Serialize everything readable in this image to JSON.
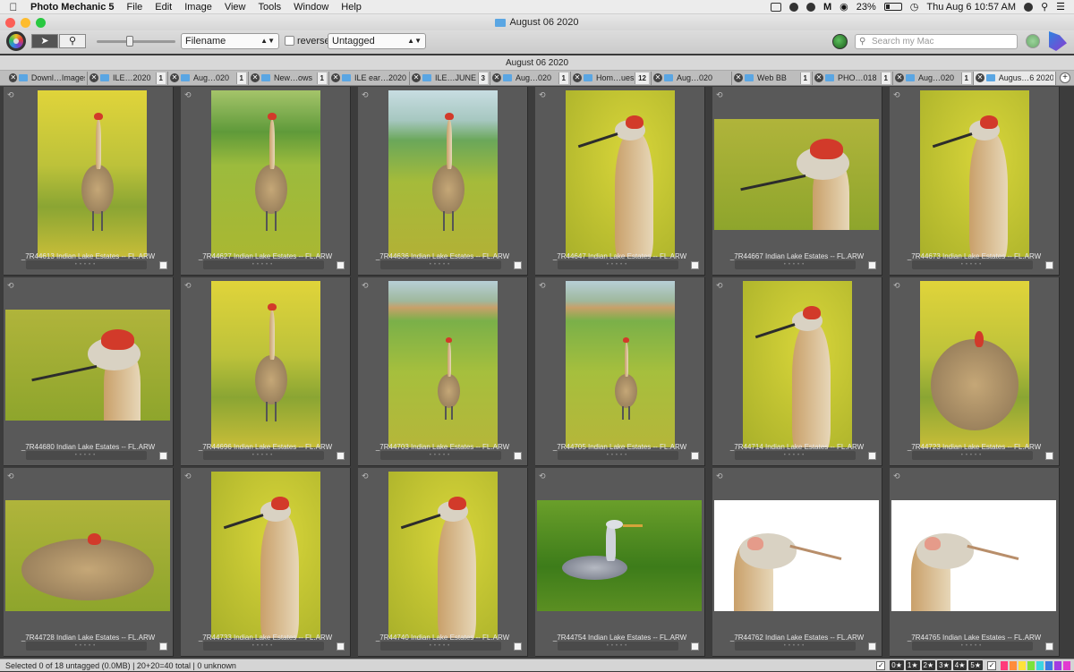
{
  "menubar": {
    "apple": "",
    "app_name": "Photo Mechanic 5",
    "items": [
      "File",
      "Edit",
      "Image",
      "View",
      "Tools",
      "Window",
      "Help"
    ],
    "battery": "23%",
    "datetime": "Thu Aug 6  10:57 AM"
  },
  "window": {
    "title": "August 06 2020"
  },
  "toolbar": {
    "sort_field": "Filename",
    "reverse_label": "reverse",
    "filter": "Untagged",
    "search_placeholder": "Search my Mac"
  },
  "contact_sheet": {
    "title": "August 06 2020"
  },
  "tabs": [
    {
      "name": "Downl…Images",
      "count": "",
      "active": false
    },
    {
      "name": "ILE…2020",
      "count": "1",
      "active": false
    },
    {
      "name": "Aug…020",
      "count": "1",
      "active": false
    },
    {
      "name": "New…ows",
      "count": "1",
      "active": false
    },
    {
      "name": "ILE ear…2020",
      "count": "",
      "active": false
    },
    {
      "name": "ILE…JUNE",
      "count": "3",
      "active": false
    },
    {
      "name": "Aug…020",
      "count": "1",
      "active": false
    },
    {
      "name": "Hom…ues",
      "count": "12",
      "active": false
    },
    {
      "name": "Aug…020",
      "count": "",
      "active": false
    },
    {
      "name": "Web BB",
      "count": "1",
      "active": false
    },
    {
      "name": "PHO…018",
      "count": "1",
      "active": false
    },
    {
      "name": "Aug…020",
      "count": "1",
      "active": false
    },
    {
      "name": "Augus…6 2020",
      "count": "",
      "active": true
    }
  ],
  "thumbnails": [
    {
      "caption": "_7R44613 Indian Lake Estates -- FL.ARW"
    },
    {
      "caption": "_7R44627 Indian Lake Estates -- FL.ARW"
    },
    {
      "caption": "_7R44636 Indian Lake Estates -- FL.ARW"
    },
    {
      "caption": "_7R44647 Indian Lake Estates -- FL.ARW"
    },
    {
      "caption": "_7R44667 Indian Lake Estates -- FL.ARW"
    },
    {
      "caption": "_7R44673 Indian Lake Estates -- FL.ARW"
    },
    {
      "caption": "_7R44680 Indian Lake Estates -- FL.ARW"
    },
    {
      "caption": "_7R44696 Indian Lake Estates -- FL.ARW"
    },
    {
      "caption": "_7R44703 Indian Lake Estates -- FL.ARW"
    },
    {
      "caption": "_7R44705 Indian Lake Estates -- FL.ARW"
    },
    {
      "caption": "_7R44714 Indian Lake Estates -- FL.ARW"
    },
    {
      "caption": "_7R44723 Indian Lake Estates -- FL.ARW"
    },
    {
      "caption": "_7R44728 Indian Lake Estates -- FL.ARW"
    },
    {
      "caption": "_7R44733 Indian Lake Estates -- FL.ARW"
    },
    {
      "caption": "_7R44740 Indian Lake Estates -- FL.ARW"
    },
    {
      "caption": "_7R44754 Indian Lake Estates -- FL.ARW"
    },
    {
      "caption": "_7R44762 Indian Lake Estates -- FL.ARW"
    },
    {
      "caption": "_7R44765 Indian Lake Estates -- FL.ARW"
    }
  ],
  "status": {
    "text": "Selected 0 of 18 untagged (0.0MB) | 20+20=40 total | 0 unknown",
    "star_filters": [
      "0★",
      "1★",
      "2★",
      "3★",
      "4★",
      "5★"
    ],
    "colors": [
      "#ff3b7a",
      "#ff8c3b",
      "#ffe23b",
      "#7be23b",
      "#3bd6e2",
      "#3b7ae2",
      "#a23be2",
      "#e23bd0"
    ]
  }
}
